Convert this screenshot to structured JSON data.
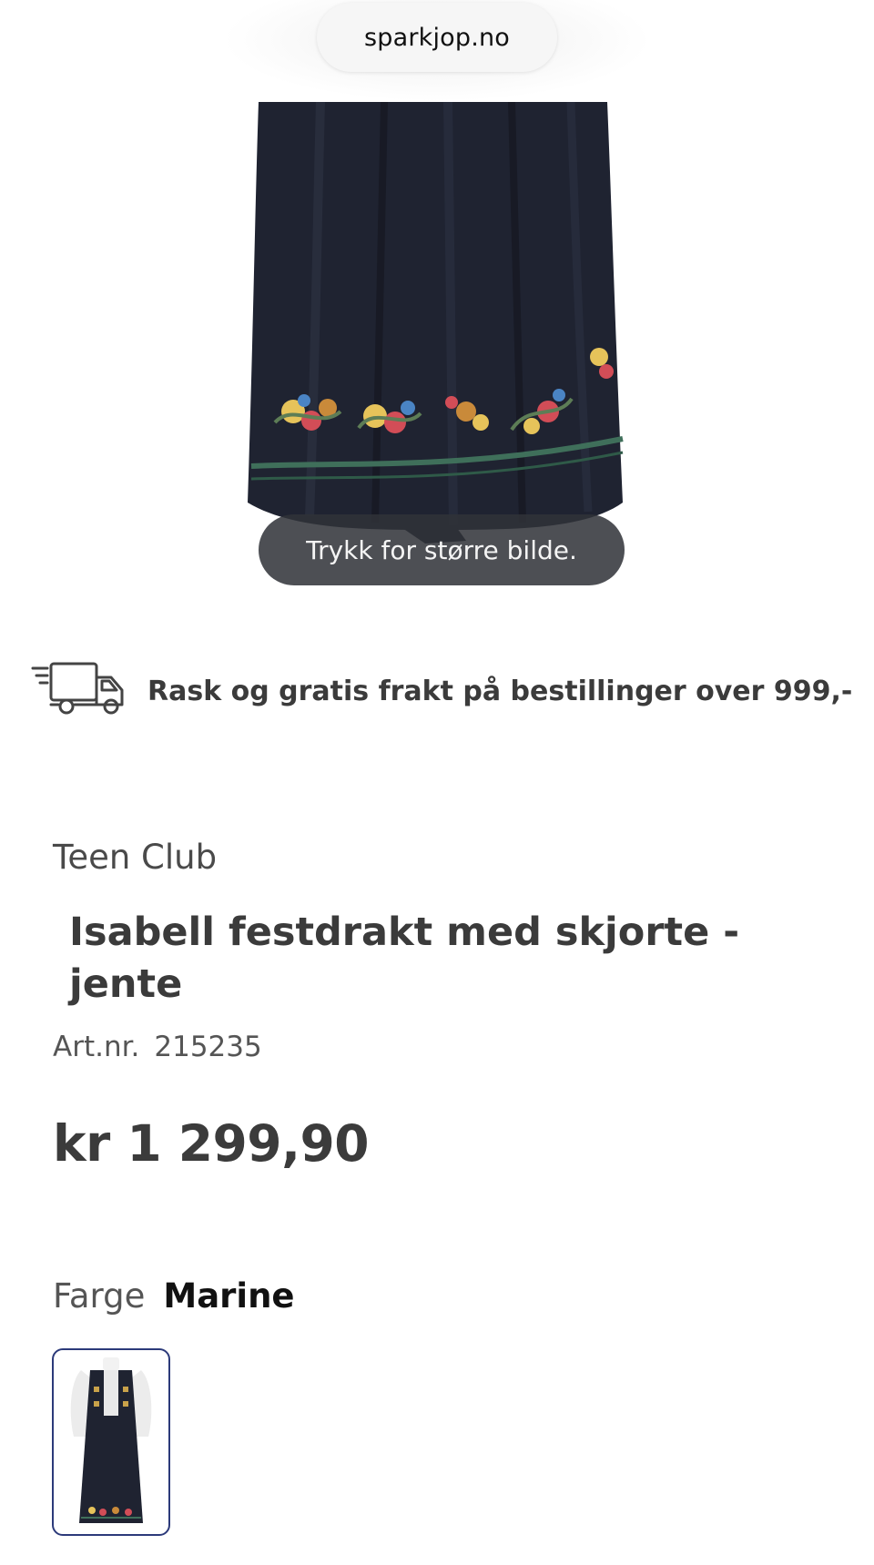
{
  "browser": {
    "url": "sparkjop.no"
  },
  "gallery": {
    "zoom_hint": "Trykk for større bilde."
  },
  "shipping": {
    "icon": "delivery-truck-icon",
    "text": "Rask og gratis frakt på bestillinger over 999,-"
  },
  "product": {
    "brand": "Teen Club",
    "title": "Isabell festdrakt med skjorte - jente",
    "art_label": "Art.nr.",
    "art_number": "215235",
    "price": "kr 1 299,90"
  },
  "color": {
    "label": "Farge",
    "selected": "Marine",
    "swatch_accent": "#2c3a7a"
  },
  "colors": {
    "fabric": "#1e2230",
    "text": "#3b3b3b"
  }
}
